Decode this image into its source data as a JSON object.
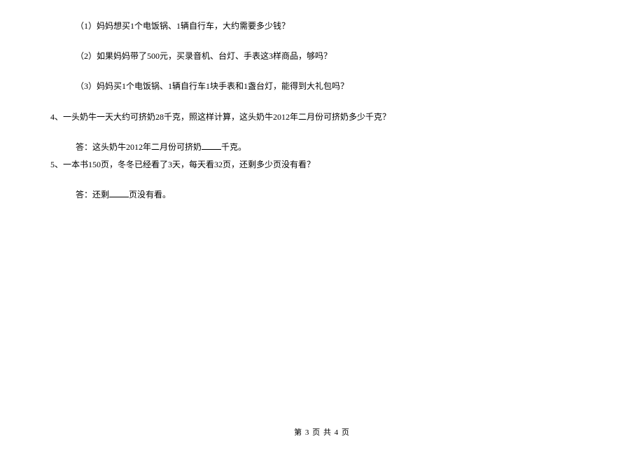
{
  "q3": {
    "sub1": "（1）妈妈想买1个电饭锅、1辆自行车，大约需要多少钱？",
    "sub2": "（2）如果妈妈带了500元，买录音机、台灯、手表这3样商品，够吗？",
    "sub3": "（3）妈妈买1个电饭锅、1辆自行车1块手表和1盏台灯，能得到大礼包吗？"
  },
  "q4": {
    "text": "4、一头奶牛一天大约可挤奶28千克，照这样计算，这头奶牛2012年二月份可挤奶多少千克？",
    "answer_prefix": "答：这头奶牛2012年二月份可挤奶",
    "answer_suffix": "千克。"
  },
  "q5": {
    "text": "5、一本书150页，冬冬已经看了3天，每天看32页，还剩多少页没有看？",
    "answer_prefix": "答：还剩",
    "answer_suffix": "页没有看。"
  },
  "footer": "第 3 页 共 4 页"
}
